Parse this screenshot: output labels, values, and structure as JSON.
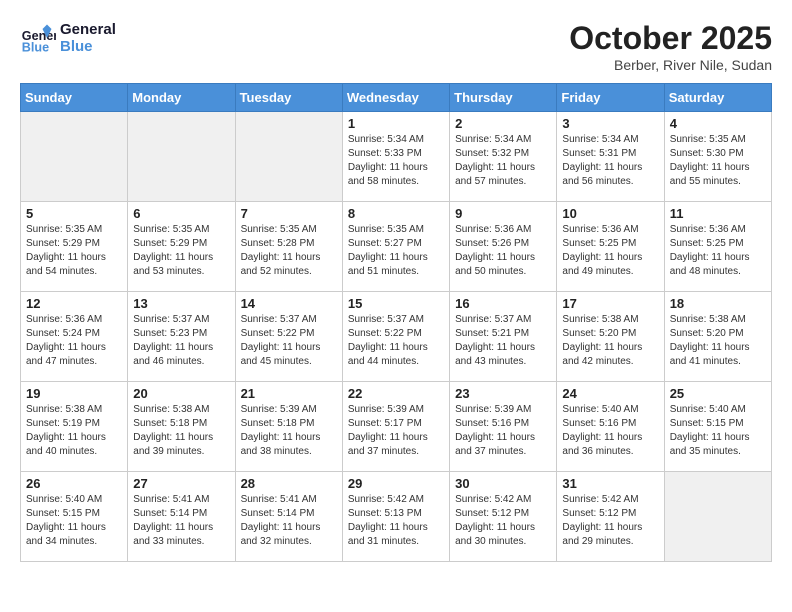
{
  "header": {
    "logo_line1": "General",
    "logo_line2": "Blue",
    "month": "October 2025",
    "location": "Berber, River Nile, Sudan"
  },
  "days_of_week": [
    "Sunday",
    "Monday",
    "Tuesday",
    "Wednesday",
    "Thursday",
    "Friday",
    "Saturday"
  ],
  "weeks": [
    [
      {
        "day": "",
        "info": ""
      },
      {
        "day": "",
        "info": ""
      },
      {
        "day": "",
        "info": ""
      },
      {
        "day": "1",
        "info": "Sunrise: 5:34 AM\nSunset: 5:33 PM\nDaylight: 11 hours\nand 58 minutes."
      },
      {
        "day": "2",
        "info": "Sunrise: 5:34 AM\nSunset: 5:32 PM\nDaylight: 11 hours\nand 57 minutes."
      },
      {
        "day": "3",
        "info": "Sunrise: 5:34 AM\nSunset: 5:31 PM\nDaylight: 11 hours\nand 56 minutes."
      },
      {
        "day": "4",
        "info": "Sunrise: 5:35 AM\nSunset: 5:30 PM\nDaylight: 11 hours\nand 55 minutes."
      }
    ],
    [
      {
        "day": "5",
        "info": "Sunrise: 5:35 AM\nSunset: 5:29 PM\nDaylight: 11 hours\nand 54 minutes."
      },
      {
        "day": "6",
        "info": "Sunrise: 5:35 AM\nSunset: 5:29 PM\nDaylight: 11 hours\nand 53 minutes."
      },
      {
        "day": "7",
        "info": "Sunrise: 5:35 AM\nSunset: 5:28 PM\nDaylight: 11 hours\nand 52 minutes."
      },
      {
        "day": "8",
        "info": "Sunrise: 5:35 AM\nSunset: 5:27 PM\nDaylight: 11 hours\nand 51 minutes."
      },
      {
        "day": "9",
        "info": "Sunrise: 5:36 AM\nSunset: 5:26 PM\nDaylight: 11 hours\nand 50 minutes."
      },
      {
        "day": "10",
        "info": "Sunrise: 5:36 AM\nSunset: 5:25 PM\nDaylight: 11 hours\nand 49 minutes."
      },
      {
        "day": "11",
        "info": "Sunrise: 5:36 AM\nSunset: 5:25 PM\nDaylight: 11 hours\nand 48 minutes."
      }
    ],
    [
      {
        "day": "12",
        "info": "Sunrise: 5:36 AM\nSunset: 5:24 PM\nDaylight: 11 hours\nand 47 minutes."
      },
      {
        "day": "13",
        "info": "Sunrise: 5:37 AM\nSunset: 5:23 PM\nDaylight: 11 hours\nand 46 minutes."
      },
      {
        "day": "14",
        "info": "Sunrise: 5:37 AM\nSunset: 5:22 PM\nDaylight: 11 hours\nand 45 minutes."
      },
      {
        "day": "15",
        "info": "Sunrise: 5:37 AM\nSunset: 5:22 PM\nDaylight: 11 hours\nand 44 minutes."
      },
      {
        "day": "16",
        "info": "Sunrise: 5:37 AM\nSunset: 5:21 PM\nDaylight: 11 hours\nand 43 minutes."
      },
      {
        "day": "17",
        "info": "Sunrise: 5:38 AM\nSunset: 5:20 PM\nDaylight: 11 hours\nand 42 minutes."
      },
      {
        "day": "18",
        "info": "Sunrise: 5:38 AM\nSunset: 5:20 PM\nDaylight: 11 hours\nand 41 minutes."
      }
    ],
    [
      {
        "day": "19",
        "info": "Sunrise: 5:38 AM\nSunset: 5:19 PM\nDaylight: 11 hours\nand 40 minutes."
      },
      {
        "day": "20",
        "info": "Sunrise: 5:38 AM\nSunset: 5:18 PM\nDaylight: 11 hours\nand 39 minutes."
      },
      {
        "day": "21",
        "info": "Sunrise: 5:39 AM\nSunset: 5:18 PM\nDaylight: 11 hours\nand 38 minutes."
      },
      {
        "day": "22",
        "info": "Sunrise: 5:39 AM\nSunset: 5:17 PM\nDaylight: 11 hours\nand 37 minutes."
      },
      {
        "day": "23",
        "info": "Sunrise: 5:39 AM\nSunset: 5:16 PM\nDaylight: 11 hours\nand 37 minutes."
      },
      {
        "day": "24",
        "info": "Sunrise: 5:40 AM\nSunset: 5:16 PM\nDaylight: 11 hours\nand 36 minutes."
      },
      {
        "day": "25",
        "info": "Sunrise: 5:40 AM\nSunset: 5:15 PM\nDaylight: 11 hours\nand 35 minutes."
      }
    ],
    [
      {
        "day": "26",
        "info": "Sunrise: 5:40 AM\nSunset: 5:15 PM\nDaylight: 11 hours\nand 34 minutes."
      },
      {
        "day": "27",
        "info": "Sunrise: 5:41 AM\nSunset: 5:14 PM\nDaylight: 11 hours\nand 33 minutes."
      },
      {
        "day": "28",
        "info": "Sunrise: 5:41 AM\nSunset: 5:14 PM\nDaylight: 11 hours\nand 32 minutes."
      },
      {
        "day": "29",
        "info": "Sunrise: 5:42 AM\nSunset: 5:13 PM\nDaylight: 11 hours\nand 31 minutes."
      },
      {
        "day": "30",
        "info": "Sunrise: 5:42 AM\nSunset: 5:12 PM\nDaylight: 11 hours\nand 30 minutes."
      },
      {
        "day": "31",
        "info": "Sunrise: 5:42 AM\nSunset: 5:12 PM\nDaylight: 11 hours\nand 29 minutes."
      },
      {
        "day": "",
        "info": ""
      }
    ]
  ]
}
